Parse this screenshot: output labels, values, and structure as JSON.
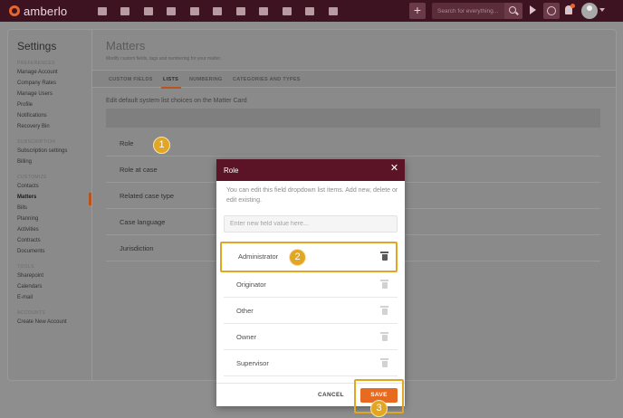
{
  "topbar": {
    "logo_text": "amberlo",
    "nav_icons": [
      "dashboard-icon",
      "contacts-icon",
      "matters-icon",
      "documents-icon",
      "billing-icon",
      "calendar-icon",
      "activity-icon",
      "folder-icon",
      "notes-icon",
      "mail-icon",
      "reports-icon"
    ],
    "add_label": "+",
    "search_placeholder": "Search for everything..."
  },
  "sidebar": {
    "title": "Settings",
    "groups": [
      {
        "label": "PREFERENCES",
        "items": [
          "Manage Account",
          "Company Rates",
          "Manage Users",
          "Profile",
          "Notifications",
          "Recovery Bin"
        ]
      },
      {
        "label": "SUBSCRIPTION",
        "items": [
          "Subscription settings",
          "Billing"
        ]
      },
      {
        "label": "CUSTOMIZE",
        "items": [
          "Contacts",
          "Matters",
          "Bills",
          "Planning",
          "Activities",
          "Contracts",
          "Documents"
        ]
      },
      {
        "label": "TOOLS",
        "items": [
          "Sharepoint",
          "Calendars",
          "E-mail"
        ]
      },
      {
        "label": "ACCOUNTS",
        "items": [
          "Create New Account"
        ]
      }
    ],
    "active_item": "Matters"
  },
  "main": {
    "title": "Matters",
    "subtitle": "Modify custom fields, tags and numbering for your matter.",
    "tabs": [
      "CUSTOM FIELDS",
      "LISTS",
      "NUMBERING",
      "CATEGORIES AND TYPES"
    ],
    "active_tab": "LISTS",
    "section_heading": "Edit default system list choices on the Matter Card",
    "lists": [
      "Role",
      "Role at case",
      "Related case type",
      "Case language",
      "Jurisdiction"
    ]
  },
  "dialog": {
    "title": "Role",
    "close": "✕",
    "description": "You can edit this field dropdown list items. Add new, delete or edit existing.",
    "input_placeholder": "Enter new field value here...",
    "options": [
      "Administrator",
      "Originator",
      "Other",
      "Owner",
      "Supervisor"
    ],
    "cancel_label": "CANCEL",
    "save_label": "SAVE"
  },
  "callouts": [
    "1",
    "2",
    "3"
  ],
  "colors": {
    "accent": "#e66a1f",
    "brand": "#5a1425",
    "callout": "#e3a623"
  }
}
